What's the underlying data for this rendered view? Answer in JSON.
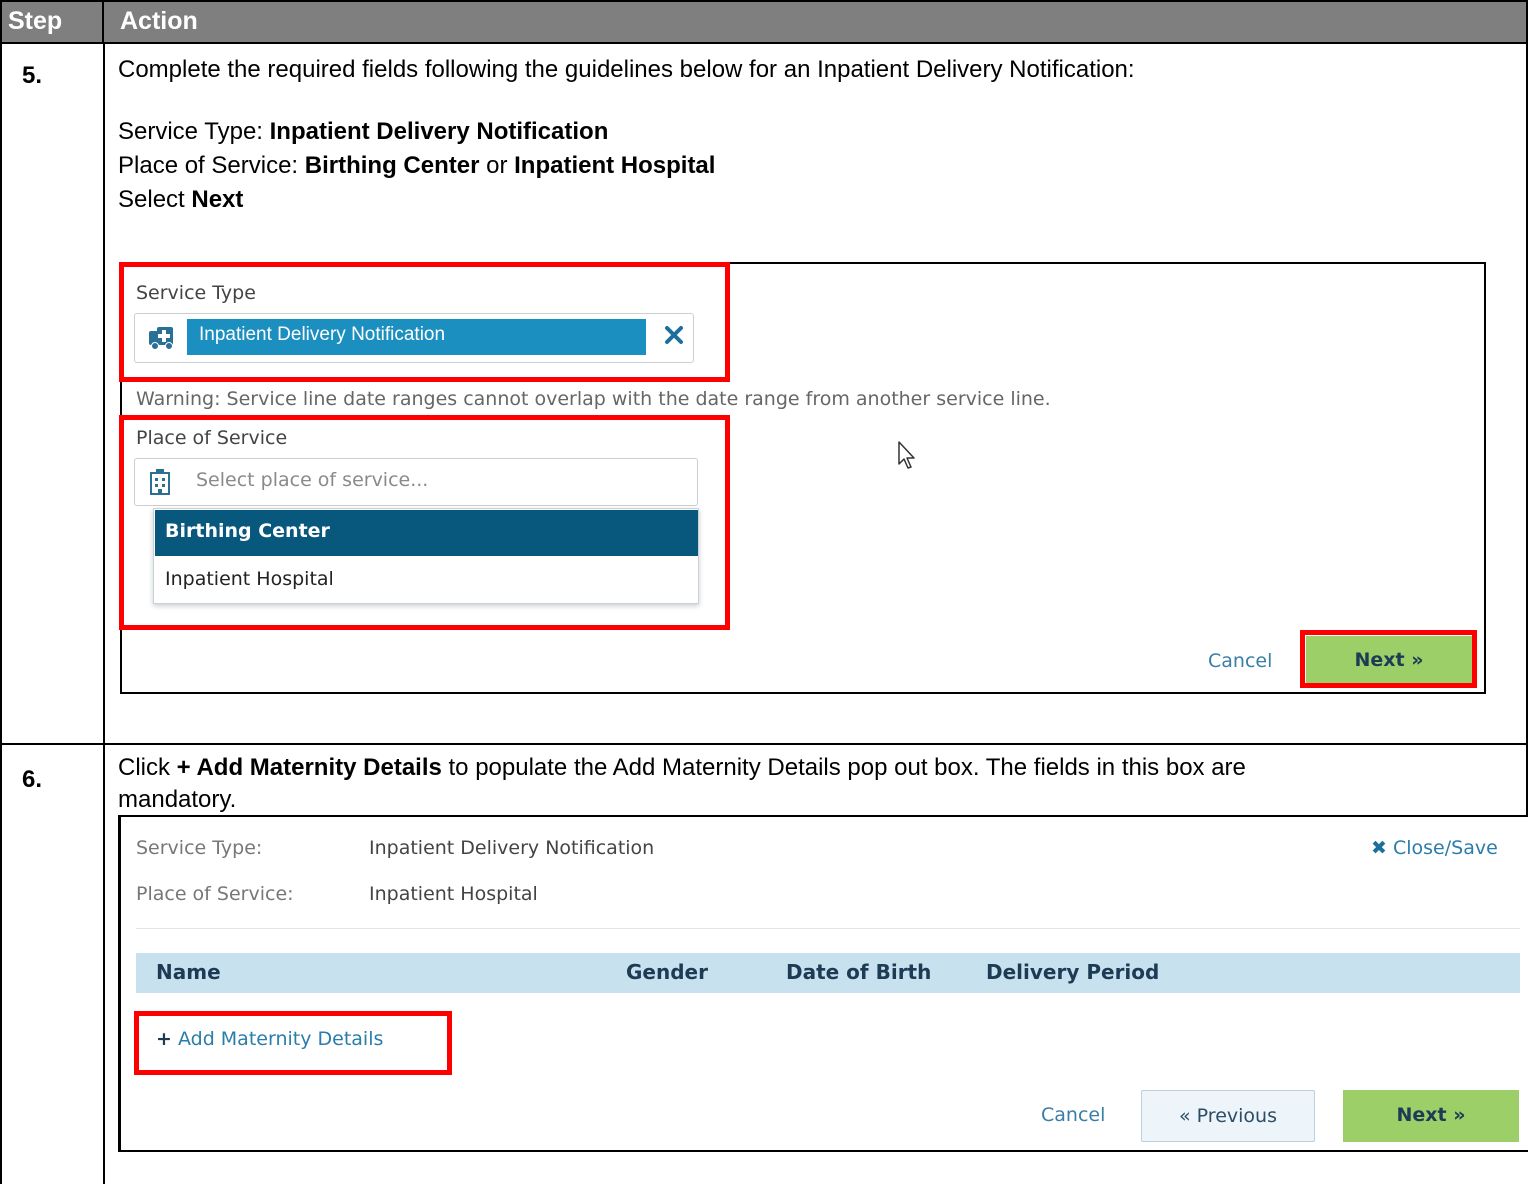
{
  "table": {
    "header_step": "Step",
    "header_action": "Action"
  },
  "step5": {
    "number": "5.",
    "intro": "Complete the required fields following the guidelines below for an Inpatient Delivery Notification:",
    "service_type_prefix": "Service Type: ",
    "service_type_value": "Inpatient Delivery Notification",
    "place_prefix": "Place of Service: ",
    "place_value1": "Birthing Center",
    "place_or": " or ",
    "place_value2": "Inpatient Hospital",
    "select_prefix": "Select ",
    "select_value": "Next",
    "ui": {
      "service_type_label": "Service Type",
      "service_type_chip": "Inpatient Delivery Notification",
      "warning": "Warning: Service line date ranges cannot overlap with the date range from another service line.",
      "place_label": "Place of Service",
      "place_placeholder": "Select place of service...",
      "options": [
        "Birthing Center",
        "Inpatient Hospital"
      ],
      "cancel": "Cancel",
      "next": "Next »"
    }
  },
  "step6": {
    "number": "6.",
    "line1_prefix": "Click ",
    "line1_bold": "+ Add Maternity Details",
    "line1_suffix": " to populate the Add Maternity Details pop out box. The fields in this box are",
    "line2": "mandatory.",
    "ui": {
      "service_type_label": "Service Type:",
      "service_type_value": "Inpatient Delivery Notification",
      "place_label": "Place of Service:",
      "place_value": "Inpatient Hospital",
      "close_save": "Close/Save",
      "columns": [
        "Name",
        "Gender",
        "Date of Birth",
        "Delivery Period"
      ],
      "add_details": "Add Maternity Details",
      "cancel": "Cancel",
      "previous": "« Previous",
      "next": "Next »"
    }
  },
  "colors": {
    "highlight": "#ff0000",
    "header_bg": "#7f7f7f",
    "chip_bg": "#1b8fbf",
    "selected_option": "#08577d",
    "next_button": "#9ccf67"
  }
}
